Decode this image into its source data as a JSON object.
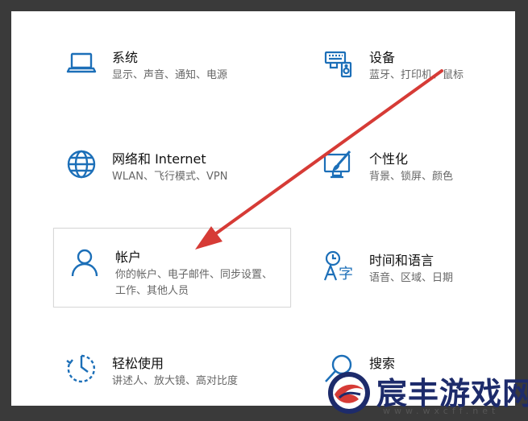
{
  "settings": {
    "tiles": [
      {
        "title": "系统",
        "desc": "显示、声音、通知、电源",
        "icon": "laptop-icon"
      },
      {
        "title": "设备",
        "desc": "蓝牙、打印机、鼠标",
        "icon": "devices-icon"
      },
      {
        "title": "网络和 Internet",
        "desc": "WLAN、飞行模式、VPN",
        "icon": "globe-icon"
      },
      {
        "title": "个性化",
        "desc": "背景、锁屏、颜色",
        "icon": "paintbrush-icon"
      },
      {
        "title": "帐户",
        "desc": "你的帐户、电子邮件、同步设置、工作、其他人员",
        "icon": "person-icon"
      },
      {
        "title": "时间和语言",
        "desc": "语音、区域、日期",
        "icon": "time-language-icon"
      },
      {
        "title": "轻松使用",
        "desc": "讲述人、放大镜、高对比度",
        "icon": "ease-of-access-icon"
      },
      {
        "title": "搜索",
        "desc": "",
        "icon": "search-icon"
      }
    ],
    "selected_tile": "帐户"
  },
  "annotation": {
    "arrow_color": "#d63b36",
    "icon_color": "#1c6fb8"
  },
  "watermark": {
    "name": "宸丰游戏网",
    "url": "www.wxcff.net"
  }
}
